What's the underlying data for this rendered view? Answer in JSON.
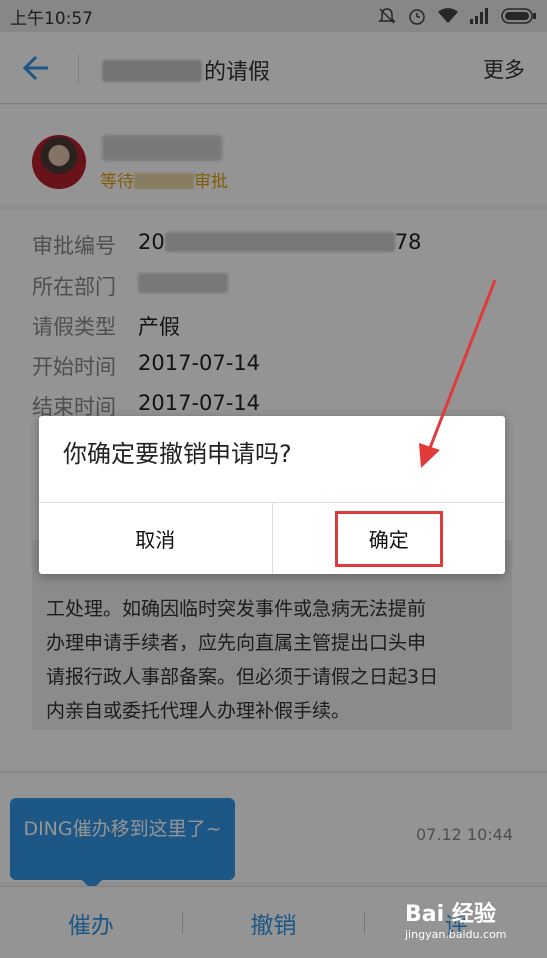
{
  "status_bar": {
    "time": "上午10:57"
  },
  "header": {
    "title_suffix": "的请假",
    "more": "更多"
  },
  "applicant": {
    "status_prefix": "等待",
    "status_suffix": "审批"
  },
  "details": {
    "rows": [
      {
        "label": "审批编号",
        "value_prefix": "20",
        "value_suffix": "78"
      },
      {
        "label": "所在部门",
        "value": ""
      },
      {
        "label": "请假类型",
        "value": "产假"
      },
      {
        "label": "开始时间",
        "value": "2017-07-14"
      },
      {
        "label": "结束时间",
        "value": "2017-07-14"
      }
    ],
    "reason_lines": [
      "工处理。如确因临时突发事件或急病无法提前",
      "办理申请手续者，应先向直属主管提出口头申",
      "请报行政人事部备案。但必须于请假之日起3日",
      "内亲自或委托代理人办理补假手续。"
    ]
  },
  "footer": {
    "timestamp": "07.12 10:44"
  },
  "tooltip": {
    "text": "DING催办移到这里了~"
  },
  "bottom_bar": {
    "tabs": [
      "催办",
      "撤销",
      "评"
    ]
  },
  "dialog": {
    "message": "你确定要撤销申请吗?",
    "cancel": "取消",
    "confirm": "确定"
  },
  "watermark": {
    "logo": "Bai 经验",
    "url": "jingyan.baidu.com"
  },
  "colors": {
    "accent": "#3296e6",
    "warning": "#e0a010",
    "annotation": "#e03a3a"
  }
}
